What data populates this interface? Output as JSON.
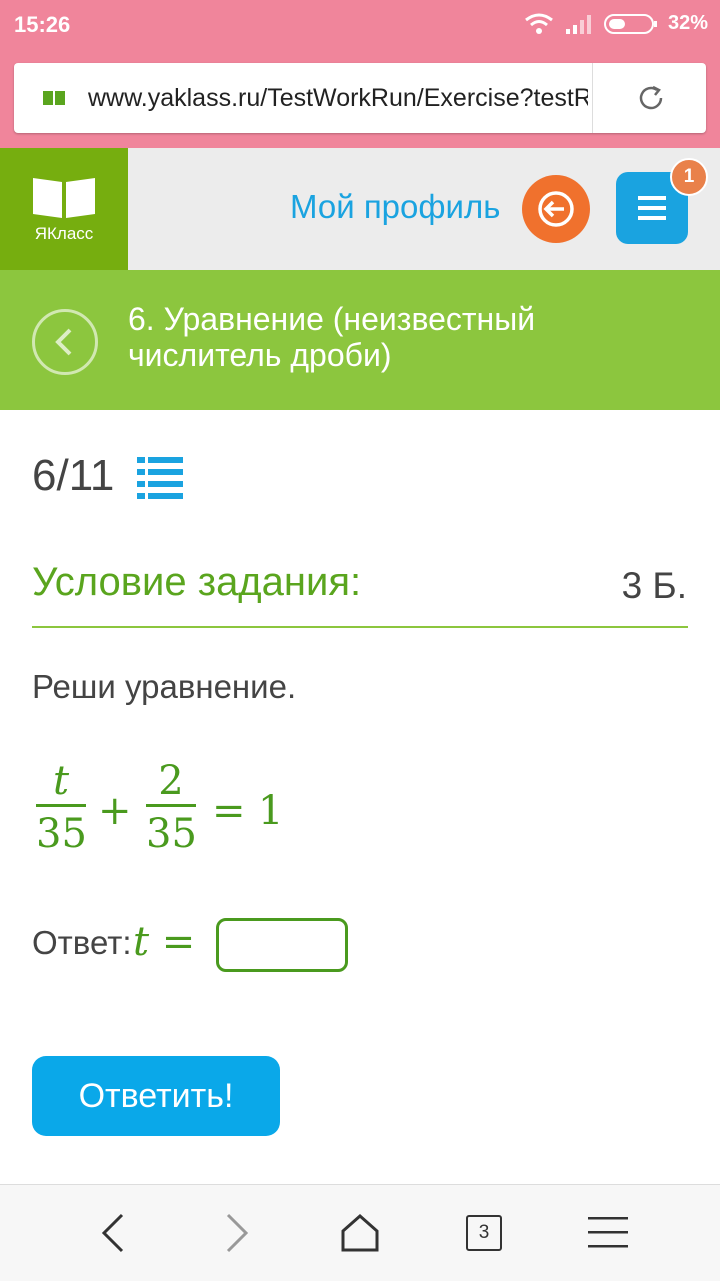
{
  "status": {
    "time": "15:26",
    "battery": "32%"
  },
  "browser": {
    "url": "www.yaklass.ru/TestWorkRun/Exercise?testR"
  },
  "header": {
    "logo_text": "ЯКласс",
    "profile_label": "Мой профиль",
    "notification_count": "1"
  },
  "topic": {
    "title": "6. Уравнение (неизвестный числитель дроби)"
  },
  "task": {
    "progress": "6/11",
    "section_title": "Условие задания:",
    "points": "3 Б.",
    "instruction": "Реши уравнение.",
    "equation": {
      "frac1_num": "t",
      "frac1_den": "35",
      "plus": "+",
      "frac2_num": "2",
      "frac2_den": "35",
      "equals": "=",
      "rhs": "1"
    },
    "answer_label": "Ответ:",
    "answer_var": "t =",
    "answer_value": "",
    "submit_label": "Ответить!"
  },
  "navbar": {
    "tabs_count": "3"
  },
  "colors": {
    "status_bar": "#f0859b",
    "logo_green": "#76ae0f",
    "topic_green": "#8cc63e",
    "accent_blue": "#1aa3e0",
    "exit_orange": "#f0712d",
    "math_green": "#4a9a1e"
  }
}
